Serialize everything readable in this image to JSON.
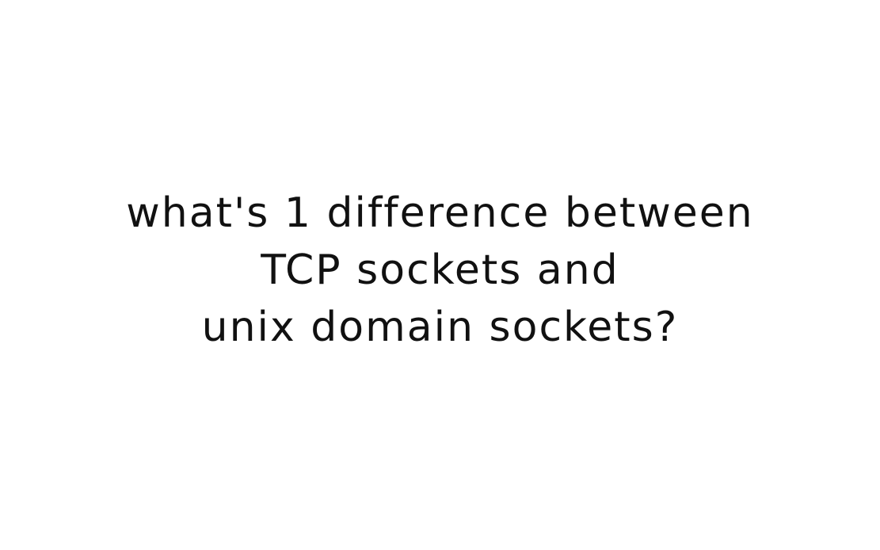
{
  "question": {
    "lines": [
      "what's 1 difference between",
      "TCP sockets and",
      "unix domain sockets?"
    ]
  },
  "colors": {
    "background": "#ffffff",
    "text": "#111111"
  }
}
